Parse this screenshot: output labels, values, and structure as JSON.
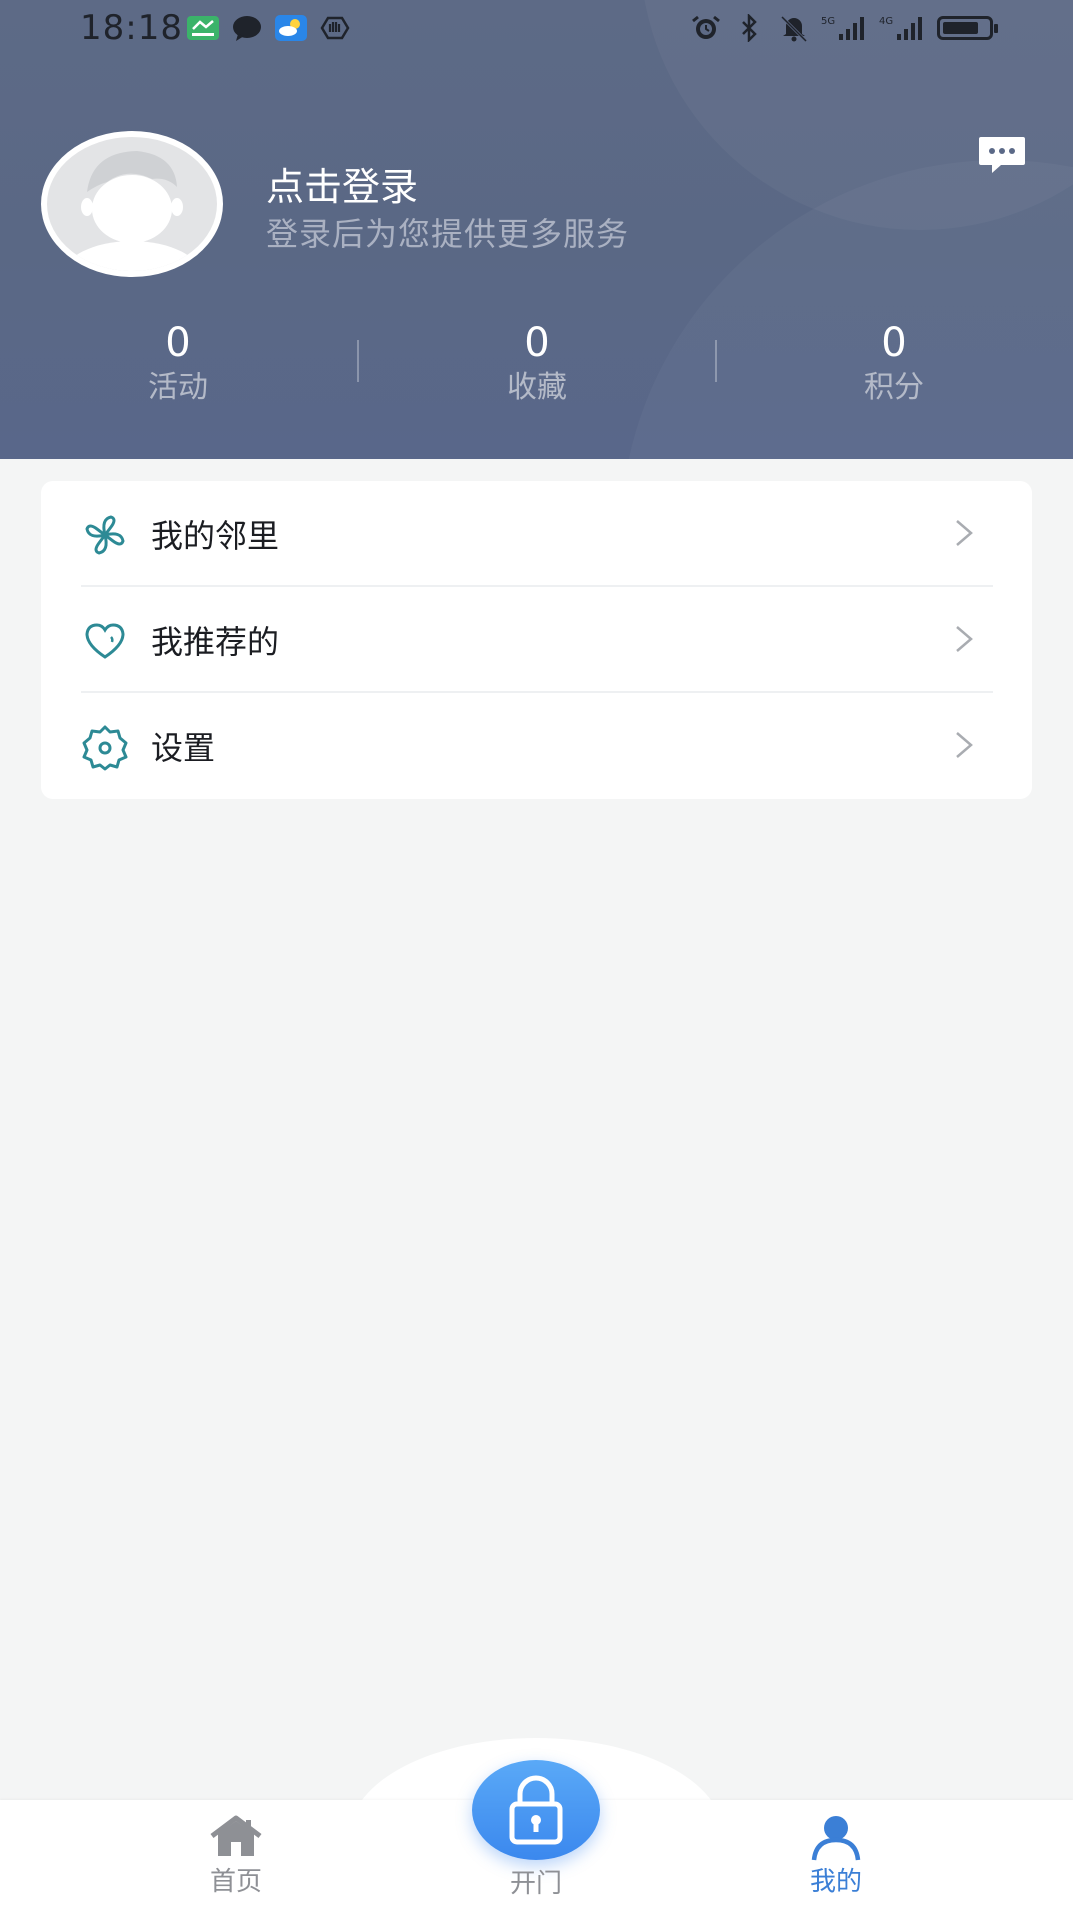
{
  "status_bar": {
    "time": "18:18",
    "left_icons": [
      "wonly-app-icon",
      "chat-bubble-icon",
      "weather-icon",
      "hand-icon"
    ],
    "right_icons": [
      "alarm-icon",
      "bluetooth-icon",
      "mute-bell-icon",
      "signal-5g-icon",
      "signal-4g-icon",
      "battery-icon"
    ]
  },
  "profile": {
    "login_title": "点击登录",
    "login_subtitle": "登录后为您提供更多服务",
    "message_icon": "message-icon"
  },
  "stats": [
    {
      "value": "0",
      "label": "活动"
    },
    {
      "value": "0",
      "label": "收藏"
    },
    {
      "value": "0",
      "label": "积分"
    }
  ],
  "menu": [
    {
      "label": "我的邻里",
      "icon": "pinwheel-icon"
    },
    {
      "label": "我推荐的",
      "icon": "heart-icon"
    },
    {
      "label": "设置",
      "icon": "settings-icon"
    }
  ],
  "tabbar": {
    "home_label": "首页",
    "open_label": "开门",
    "mine_label": "我的"
  },
  "colors": {
    "header_bg": "#5b6987",
    "accent": "#3b88ee",
    "icon_teal": "#2d8a95",
    "tab_active": "#3b7fd6",
    "tab_inactive": "#8e9095"
  }
}
